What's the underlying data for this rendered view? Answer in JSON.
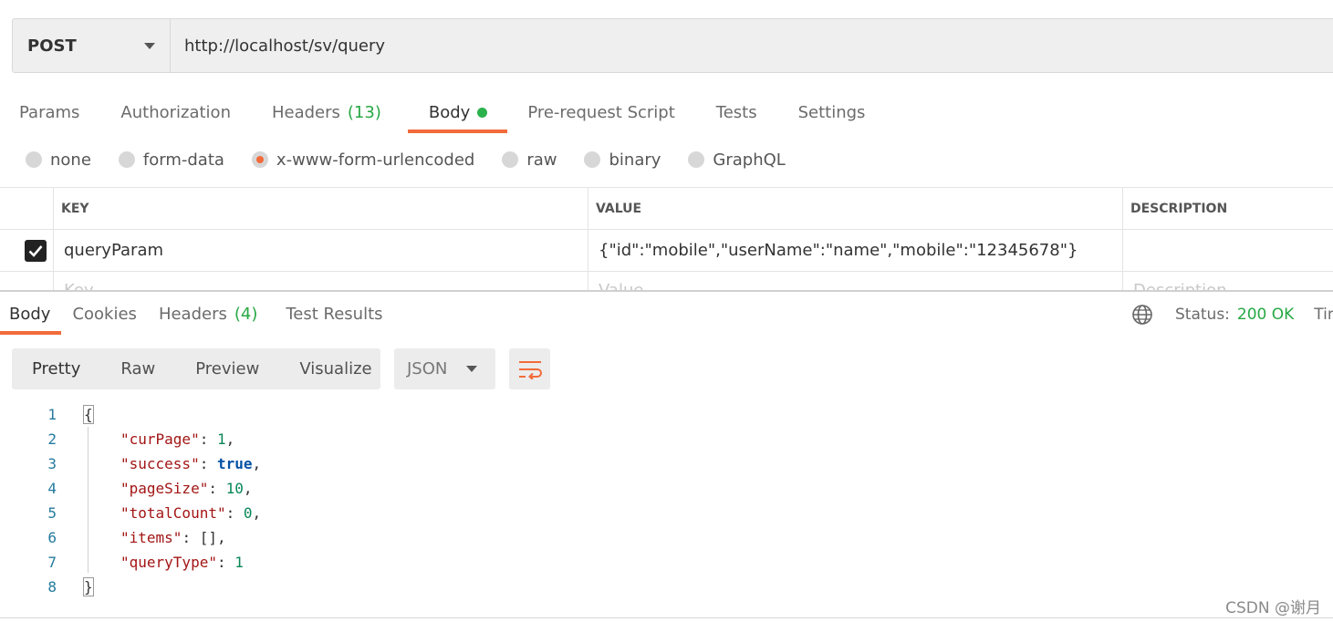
{
  "request": {
    "method": "POST",
    "url": "http://localhost/sv/query"
  },
  "request_tabs": [
    {
      "label": "Params",
      "count": ""
    },
    {
      "label": "Authorization",
      "count": ""
    },
    {
      "label": "Headers",
      "count": "(13)"
    },
    {
      "label": "Body",
      "count": ""
    },
    {
      "label": "Pre-request Script",
      "count": ""
    },
    {
      "label": "Tests",
      "count": ""
    },
    {
      "label": "Settings",
      "count": ""
    }
  ],
  "active_request_tab": "Body",
  "body_types": [
    "none",
    "form-data",
    "x-www-form-urlencoded",
    "raw",
    "binary",
    "GraphQL"
  ],
  "selected_body_type": "x-www-form-urlencoded",
  "params_table": {
    "headers": {
      "key": "KEY",
      "value": "VALUE",
      "description": "DESCRIPTION"
    },
    "rows": [
      {
        "checked": true,
        "key": "queryParam",
        "value": "{\"id\":\"mobile\",\"userName\":\"name\",\"mobile\":\"12345678\"}",
        "description": ""
      }
    ],
    "placeholder": {
      "key": "Key",
      "value": "Value",
      "description": "Description"
    }
  },
  "response_tabs": [
    {
      "label": "Body",
      "count": ""
    },
    {
      "label": "Cookies",
      "count": ""
    },
    {
      "label": "Headers",
      "count": "(4)"
    },
    {
      "label": "Test Results",
      "count": ""
    }
  ],
  "status": {
    "label": "Status:",
    "value": "200 OK",
    "time_label": "Time"
  },
  "format_buttons": [
    "Pretty",
    "Raw",
    "Preview",
    "Visualize"
  ],
  "language": "JSON",
  "code_lines": [
    {
      "num": "1",
      "text": "{"
    },
    {
      "num": "2",
      "key": "\"curPage\"",
      "val": "1",
      "type": "n",
      "comma": ","
    },
    {
      "num": "3",
      "key": "\"success\"",
      "val": "true",
      "type": "b",
      "comma": ","
    },
    {
      "num": "4",
      "key": "\"pageSize\"",
      "val": "10",
      "type": "n",
      "comma": ","
    },
    {
      "num": "5",
      "key": "\"totalCount\"",
      "val": "0",
      "type": "n",
      "comma": ","
    },
    {
      "num": "6",
      "key": "\"items\"",
      "val": "[]",
      "type": "p",
      "comma": ","
    },
    {
      "num": "7",
      "key": "\"queryType\"",
      "val": "1",
      "type": "n",
      "comma": ""
    },
    {
      "num": "8",
      "text": "}"
    }
  ],
  "watermark": "CSDN @谢月",
  "colors": {
    "accent": "#f26b3a",
    "success": "#27a844"
  }
}
